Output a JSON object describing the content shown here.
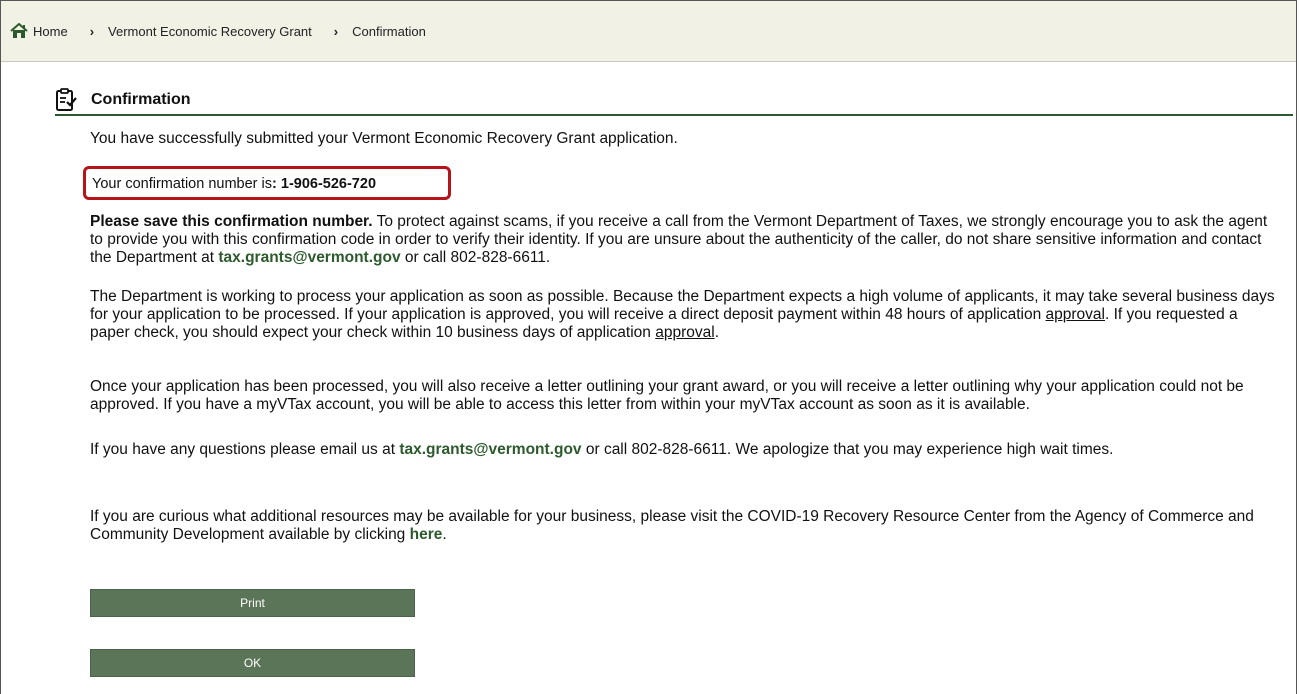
{
  "breadcrumb": {
    "home": "Home",
    "grant": "Vermont Economic Recovery Grant",
    "current": "Confirmation",
    "separator": "›"
  },
  "section": {
    "title": "Confirmation"
  },
  "intro": "You have successfully submitted your Vermont Economic Recovery Grant application.",
  "confirmation": {
    "label": "Your confirmation number is",
    "colon": ":",
    "number": "1-906-526-720"
  },
  "p1": {
    "bold": "Please save this confirmation number.",
    "text1": " To protect against scams, if you receive a call from the Vermont Department of Taxes, we strongly encourage you to ask the agent to provide you with this confirmation code in order to verify their identity. If you are unsure about the authenticity of the caller, do not share sensitive information and contact the Department at ",
    "email": "tax.grants@vermont.gov",
    "text2": " or call 802-828-6611."
  },
  "p2": {
    "text1": "The Department is working to process your application as soon as possible. Because the Department expects a high volume of applicants, it may take several business days for your application to be processed. If your application is approved, you will receive a direct deposit payment within 48 hours of application ",
    "u1": "approval",
    "text2": ". If you requested a paper check, you should expect your check within 10 business days of application ",
    "u2": "approval",
    "text3": "."
  },
  "p3": {
    "text": "Once your application has been processed, you will also receive a letter outlining your grant award, or you will receive a letter outlining why your application could not be approved. If you have a myVTax account, you will be able to access this letter from within your myVTax account as soon as it is available."
  },
  "p4": {
    "text1": "If you have any questions please email us at ",
    "email": "tax.grants@vermont.gov",
    "text2": " or call 802-828-6611. We apologize that you may experience high wait times."
  },
  "p5": {
    "text1": "If you are curious what additional resources may be available for your business, please visit the COVID-19 Recovery Resource Center from the Agency of Commerce and Community Development available by clicking ",
    "link": "here",
    "text2": "."
  },
  "buttons": {
    "print": "Print",
    "ok": "OK"
  },
  "colors": {
    "accent": "#2d5a2d",
    "button": "#5a7558",
    "highlight": "#b5141a"
  }
}
